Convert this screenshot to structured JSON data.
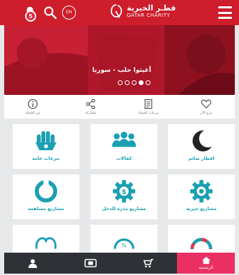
{
  "header": {
    "logo_ar": "قطـر الخيرية",
    "logo_en": "QATAR CHARITY",
    "notification_count": "5",
    "lang_label": "EN"
  },
  "banner": {
    "caption": "أغيثوا حلب - سوريا",
    "slides": 5,
    "active_slide": 4
  },
  "actions": [
    {
      "label": "عن الحملة",
      "icon": "info-icon"
    },
    {
      "label": "مشاركة",
      "icon": "share-icon"
    },
    {
      "label": "تبرعات الحملة",
      "icon": "document-icon"
    },
    {
      "label": "تبرع الآن",
      "icon": "heart-icon"
    }
  ],
  "tiles": [
    {
      "label": "تبرعات عامة",
      "icon": "hands-icon"
    },
    {
      "label": "كفالات",
      "icon": "people-icon"
    },
    {
      "label": "افطار صائم",
      "icon": "crescent-icon"
    },
    {
      "label": "مشاريع مساهمة",
      "icon": "contribution-icon"
    },
    {
      "label": "مشاريع مدرة للدخل",
      "icon": "income-gear-icon"
    },
    {
      "label": "مشاريع خيرية",
      "icon": "charity-gear-icon"
    }
  ],
  "bottom_nav": [
    {
      "label": "",
      "icon": "user-icon"
    },
    {
      "label": "",
      "icon": "wallet-icon"
    },
    {
      "label": "",
      "icon": "cart-icon"
    },
    {
      "label": "الرئيسية",
      "icon": "home-icon",
      "active": true
    }
  ],
  "colors": {
    "brand_red": "#ce1d2b",
    "teal": "#1aa0b2",
    "nav_dark": "#2e3135",
    "nav_active": "#ea2f62"
  }
}
